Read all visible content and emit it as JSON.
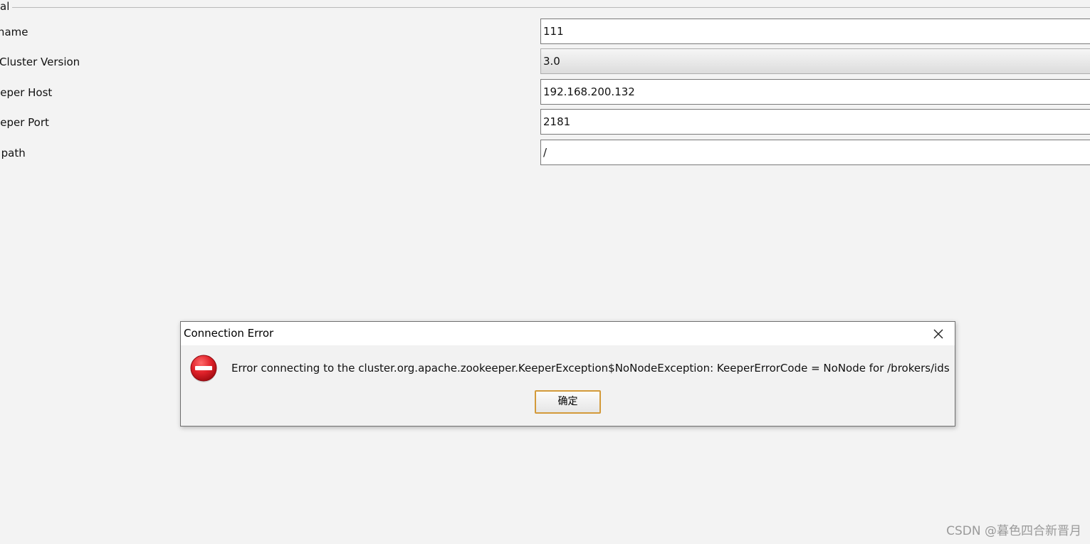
{
  "group": {
    "legend": "al"
  },
  "form": {
    "rows": [
      {
        "label": "r name",
        "value": "111"
      },
      {
        "label": "Cluster Version",
        "value": "3.0"
      },
      {
        "label": "eeper Host",
        "value": "192.168.200.132"
      },
      {
        "label": "eeper Port",
        "value": "2181"
      },
      {
        "label": "t path",
        "value": "/"
      }
    ]
  },
  "dialog": {
    "title": "Connection Error",
    "message": "Error connecting to the cluster.org.apache.zookeeper.KeeperException$NoNodeException: KeeperErrorCode = NoNode for /brokers/ids",
    "ok_label": "确定",
    "icons": {
      "error": "error-icon",
      "close": "close-icon"
    }
  },
  "watermark": "CSDN @暮色四合新晋月",
  "colors": {
    "background": "#f3f3f3",
    "error_red": "#d0141b",
    "button_border": "#d39a3a"
  }
}
